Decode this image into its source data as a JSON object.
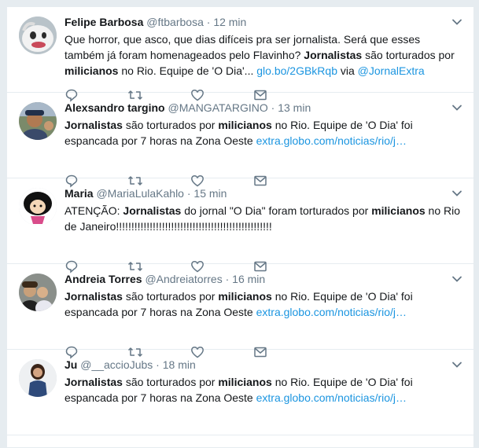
{
  "colors": {
    "link": "#1b95e0",
    "muted": "#657786",
    "text": "#14171a",
    "background": "#e6ecf0"
  },
  "tweets": [
    {
      "name": "Felipe Barbosa",
      "handle": "@ftbarbosa",
      "dot": "·",
      "time": "12 min",
      "avatar_icon": "white-creature-avatar",
      "segments": [
        {
          "t": "Que horror, que asco, que dias difíceis pra ser jornalista. Será que esses também já foram homenageados pelo Flavinho? "
        },
        {
          "t": "Jornalistas",
          "b": true
        },
        {
          "t": " são torturados por "
        },
        {
          "t": "milicianos",
          "b": true
        },
        {
          "t": " no Rio. Equipe de 'O Dia'... "
        },
        {
          "t": "glo.bo/2GBkRqb",
          "link": true
        },
        {
          "t": " via "
        },
        {
          "t": "@JornalExtra",
          "link": true
        }
      ]
    },
    {
      "name": "Alexsandro targino",
      "handle": "@MANGATARGINO",
      "dot": "·",
      "time": "13 min",
      "avatar_icon": "person-selfie-avatar",
      "segments": [
        {
          "t": "Jornalistas",
          "b": true
        },
        {
          "t": " são torturados por "
        },
        {
          "t": "milicianos",
          "b": true
        },
        {
          "t": " no Rio. Equipe de 'O Dia' foi espancada por 7 horas na Zona Oeste "
        },
        {
          "t": "extra.globo.com/noticias/rio/j…",
          "link": true
        }
      ]
    },
    {
      "name": "Maria",
      "handle": "@MariaLulaKahlo",
      "dot": "·",
      "time": "15 min",
      "avatar_icon": "cartoon-girl-avatar",
      "segments": [
        {
          "t": "ATENÇÃO: "
        },
        {
          "t": "Jornalistas",
          "b": true
        },
        {
          "t": " do jornal \"O Dia\" foram torturados por "
        },
        {
          "t": "milicianos",
          "b": true
        },
        {
          "t": " no Rio de Janeiro!!!!!!!!!!!!!!!!!!!!!!!!!!!!!!!!!!!!!!!!!!!!!!!!!!!"
        }
      ]
    },
    {
      "name": "Andreia Torres",
      "handle": "@Andreiatorres",
      "dot": "·",
      "time": "16 min",
      "avatar_icon": "group-photo-avatar",
      "segments": [
        {
          "t": "Jornalistas",
          "b": true
        },
        {
          "t": " são torturados por "
        },
        {
          "t": "milicianos",
          "b": true
        },
        {
          "t": " no Rio. Equipe de 'O Dia' foi espancada por 7 horas na Zona Oeste "
        },
        {
          "t": "extra.globo.com/noticias/rio/j…",
          "link": true
        }
      ]
    },
    {
      "name": "Ju",
      "handle": "@__accioJubs",
      "dot": "·",
      "time": "18 min",
      "avatar_icon": "woman-photo-avatar",
      "segments": [
        {
          "t": "Jornalistas",
          "b": true
        },
        {
          "t": " são torturados por "
        },
        {
          "t": "milicianos",
          "b": true
        },
        {
          "t": " no Rio. Equipe de 'O Dia' foi espancada por 7 horas na Zona Oeste "
        },
        {
          "t": "extra.globo.com/noticias/rio/j…",
          "link": true
        }
      ]
    }
  ]
}
